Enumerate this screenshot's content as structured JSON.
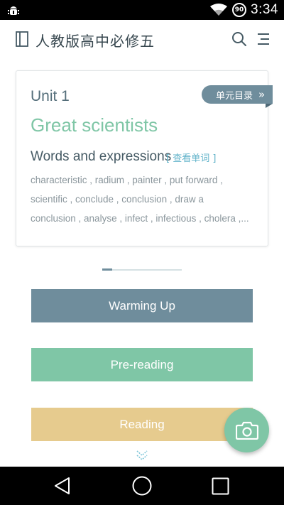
{
  "status_bar": {
    "time": "3:34",
    "battery": "90"
  },
  "app_bar": {
    "title": "人教版高中必修五"
  },
  "card": {
    "unit_label": "Unit 1",
    "unit_title": "Great scientists",
    "toc_label": "单元目录",
    "words_heading": "Words and expressions",
    "view_words_label": "[ 查看单词 ]",
    "vocab_lines": [
      "characteristic , radium , painter , put forward ,",
      "scientific , conclude , conclusion , draw a",
      "conclusion , analyse , infect , infectious , cholera ,..."
    ]
  },
  "pager": {
    "current": 1
  },
  "sections": [
    {
      "label": "Warming Up",
      "color": "#6f8d9c"
    },
    {
      "label": "Pre-reading",
      "color": "#7fc6a6"
    },
    {
      "label": "Reading",
      "color": "#e6cb8e"
    }
  ],
  "icons": {
    "status_left": "android-debug-icon",
    "wifi": "wifi-icon",
    "book": "book-icon",
    "search": "search-icon",
    "menu": "menu-icon",
    "toc_chevron": "double-chevron-right-icon",
    "more": "chevron-down-icon",
    "fab": "camera-icon",
    "nav_back": "back-icon",
    "nav_home": "home-icon",
    "nav_recent": "recent-apps-icon"
  },
  "colors": {
    "primary_slate": "#6f8d9c",
    "accent_green": "#7fc6a6",
    "accent_yellow": "#e6cb8e",
    "link_blue": "#5fb2c9"
  }
}
